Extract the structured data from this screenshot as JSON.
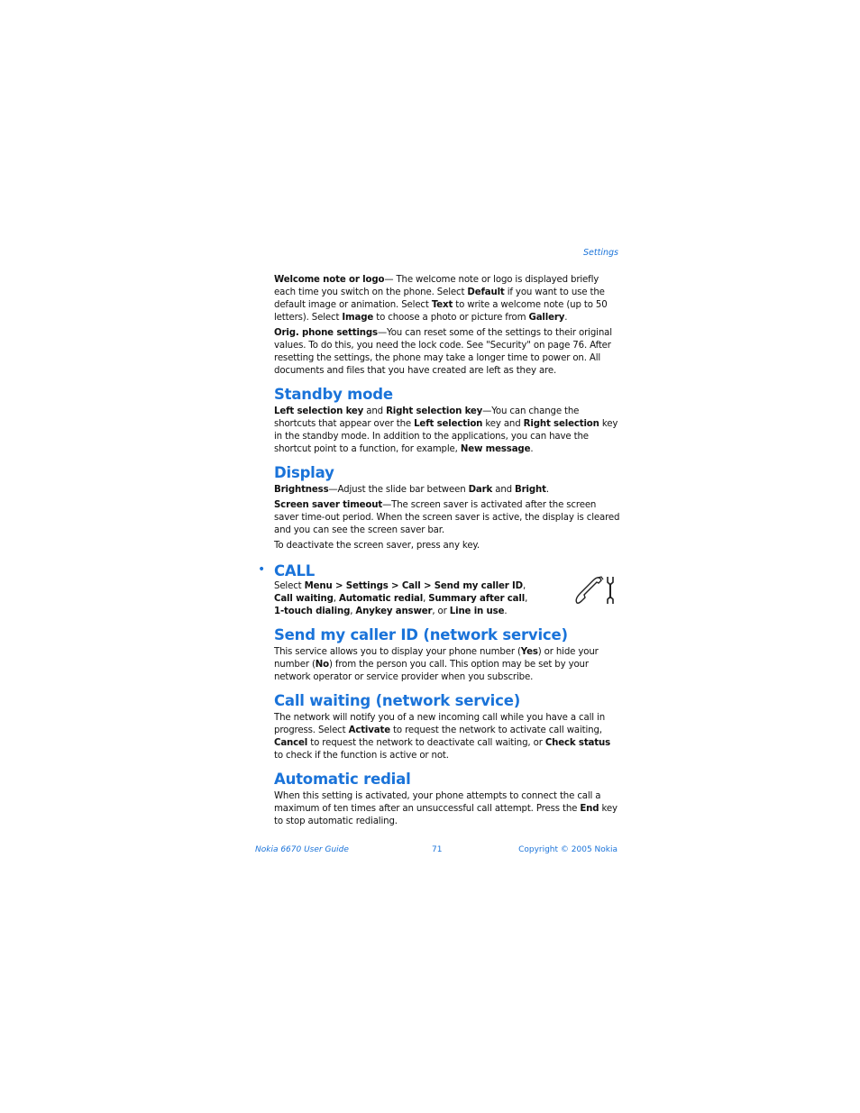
{
  "running_head": "Settings",
  "intro": {
    "welcome": {
      "term": "Welcome note or logo",
      "t1": "— The welcome note or logo is displayed briefly each time you switch on the phone. Select ",
      "b1": "Default",
      "t2": " if you want to use the default image or animation. Select ",
      "b2": "Text",
      "t3": " to write a welcome note (up to 50 letters). Select ",
      "b3": "Image",
      "t4": " to choose a photo or picture from ",
      "b4": "Gallery",
      "t5": "."
    },
    "orig": {
      "term": "Orig. phone settings",
      "t1": "—You can reset some of the settings to their original values. To do this, you need the lock code. See \"Security\" on page 76. After resetting the settings, the phone may take a longer time to power on. All documents and files that you have created are left as they are."
    }
  },
  "standby": {
    "heading": "Standby mode",
    "b1": "Left selection key",
    "t1": " and ",
    "b2": "Right selection key",
    "t2": "—You can change the shortcuts that appear over the ",
    "b3": "Left selection",
    "t3": " key and ",
    "b4": "Right selection",
    "t4": " key in the standby mode. In addition to the applications, you can have the shortcut point to a function, for example, ",
    "b5": "New message",
    "t5": "."
  },
  "display": {
    "heading": "Display",
    "brightness": {
      "term": "Brightness",
      "t1": "—Adjust the slide bar between ",
      "b1": "Dark",
      "t2": " and ",
      "b2": "Bright",
      "t3": "."
    },
    "saver": {
      "term": "Screen saver timeout",
      "t1": "—The screen saver is activated after the screen saver time-out period. When the screen saver is active, the display is cleared and you can see the screen saver bar."
    },
    "deactivate": "To deactivate the screen saver, press any key."
  },
  "call": {
    "bullet": "•",
    "heading": "CALL",
    "icon": "phone-wrench-icon",
    "t1": "Select ",
    "b1": "Menu > Settings > Call > Send my caller ID",
    "t2": ", ",
    "b2": "Call waiting",
    "t3": ", ",
    "b3": "Automatic redial",
    "t4": ", ",
    "b4": "Summary after call",
    "t5": ", ",
    "b5": "1-touch dialing",
    "t6": ", ",
    "b6": "Anykey answer",
    "t7": ", or ",
    "b7": "Line in use",
    "t8": "."
  },
  "caller_id": {
    "heading": "Send my caller ID (network service)",
    "t1": "This service allows you to display your phone number (",
    "b1": "Yes",
    "t2": ") or hide your number (",
    "b2": "No",
    "t3": ") from the person you call. This option may be set by your network operator or service provider when you subscribe."
  },
  "call_waiting": {
    "heading": "Call waiting (network service)",
    "t1": "The network will notify you of a new incoming call while you have a call in progress. Select ",
    "b1": "Activate",
    "t2": " to request the network to activate call waiting, ",
    "b2": "Cancel",
    "t3": " to request the network to deactivate call waiting, or ",
    "b3": "Check status",
    "t4": " to check if the function is active or not."
  },
  "redial": {
    "heading": "Automatic redial",
    "t1": "When this setting is activated, your phone attempts to connect the call a maximum of ten times after an unsuccessful call attempt. Press the ",
    "b1": "End",
    "t2": " key to stop automatic redialing."
  },
  "footer": {
    "guide": "Nokia 6670 User Guide",
    "page": "71",
    "copyright": "Copyright © 2005 Nokia"
  }
}
